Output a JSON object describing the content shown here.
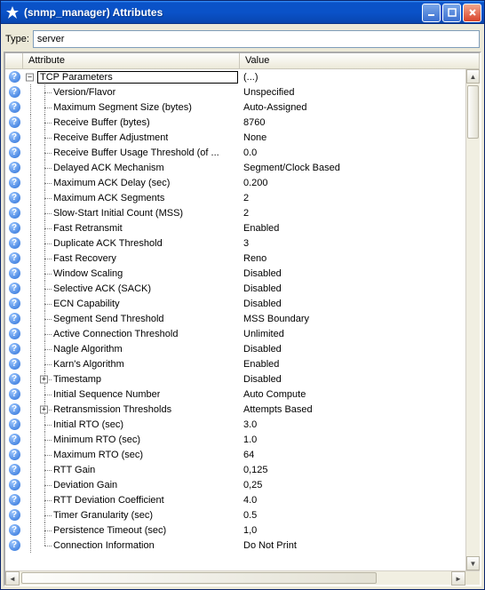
{
  "window": {
    "title": "(snmp_manager) Attributes"
  },
  "type_row": {
    "label": "Type:",
    "value": "server"
  },
  "headers": {
    "attribute": "Attribute",
    "value": "Value"
  },
  "tcp_group": {
    "label": "TCP Parameters",
    "value": "(...)"
  },
  "rows": [
    {
      "attr": "Version/Flavor",
      "val": "Unspecified",
      "depth": 2,
      "exp": null
    },
    {
      "attr": "Maximum Segment Size (bytes)",
      "val": "Auto-Assigned",
      "depth": 2,
      "exp": null
    },
    {
      "attr": "Receive Buffer (bytes)",
      "val": "8760",
      "depth": 2,
      "exp": null
    },
    {
      "attr": "Receive Buffer Adjustment",
      "val": "None",
      "depth": 2,
      "exp": null
    },
    {
      "attr": "Receive Buffer Usage Threshold (of ...",
      "val": "0.0",
      "depth": 2,
      "exp": null
    },
    {
      "attr": "Delayed ACK Mechanism",
      "val": "Segment/Clock Based",
      "depth": 2,
      "exp": null
    },
    {
      "attr": "Maximum ACK Delay (sec)",
      "val": "0.200",
      "depth": 2,
      "exp": null
    },
    {
      "attr": "Maximum ACK Segments",
      "val": "2",
      "depth": 2,
      "exp": null
    },
    {
      "attr": "Slow-Start Initial Count (MSS)",
      "val": "2",
      "depth": 2,
      "exp": null
    },
    {
      "attr": "Fast Retransmit",
      "val": "Enabled",
      "depth": 2,
      "exp": null
    },
    {
      "attr": "Duplicate ACK Threshold",
      "val": "3",
      "depth": 2,
      "exp": null
    },
    {
      "attr": "Fast Recovery",
      "val": "Reno",
      "depth": 2,
      "exp": null
    },
    {
      "attr": "Window Scaling",
      "val": "Disabled",
      "depth": 2,
      "exp": null
    },
    {
      "attr": "Selective ACK (SACK)",
      "val": "Disabled",
      "depth": 2,
      "exp": null
    },
    {
      "attr": "ECN Capability",
      "val": "Disabled",
      "depth": 2,
      "exp": null
    },
    {
      "attr": "Segment Send Threshold",
      "val": "MSS Boundary",
      "depth": 2,
      "exp": null
    },
    {
      "attr": "Active Connection Threshold",
      "val": "Unlimited",
      "depth": 2,
      "exp": null
    },
    {
      "attr": "Nagle Algorithm",
      "val": "Disabled",
      "depth": 2,
      "exp": null
    },
    {
      "attr": "Karn's Algorithm",
      "val": "Enabled",
      "depth": 2,
      "exp": null
    },
    {
      "attr": "Timestamp",
      "val": "Disabled",
      "depth": 2,
      "exp": "plus"
    },
    {
      "attr": "Initial Sequence Number",
      "val": "Auto Compute",
      "depth": 2,
      "exp": null
    },
    {
      "attr": "Retransmission Thresholds",
      "val": "Attempts Based",
      "depth": 2,
      "exp": "plus"
    },
    {
      "attr": "Initial RTO (sec)",
      "val": "3.0",
      "depth": 2,
      "exp": null
    },
    {
      "attr": "Minimum RTO (sec)",
      "val": "1.0",
      "depth": 2,
      "exp": null
    },
    {
      "attr": "Maximum RTO (sec)",
      "val": "64",
      "depth": 2,
      "exp": null
    },
    {
      "attr": "RTT Gain",
      "val": "0,125",
      "depth": 2,
      "exp": null
    },
    {
      "attr": "Deviation Gain",
      "val": "0,25",
      "depth": 2,
      "exp": null
    },
    {
      "attr": "RTT Deviation Coefficient",
      "val": "4.0",
      "depth": 2,
      "exp": null
    },
    {
      "attr": "Timer Granularity (sec)",
      "val": "0.5",
      "depth": 2,
      "exp": null
    },
    {
      "attr": "Persistence Timeout (sec)",
      "val": "1,0",
      "depth": 2,
      "exp": null
    },
    {
      "attr": "Connection Information",
      "val": "Do Not Print",
      "depth": 2,
      "exp": null
    }
  ]
}
